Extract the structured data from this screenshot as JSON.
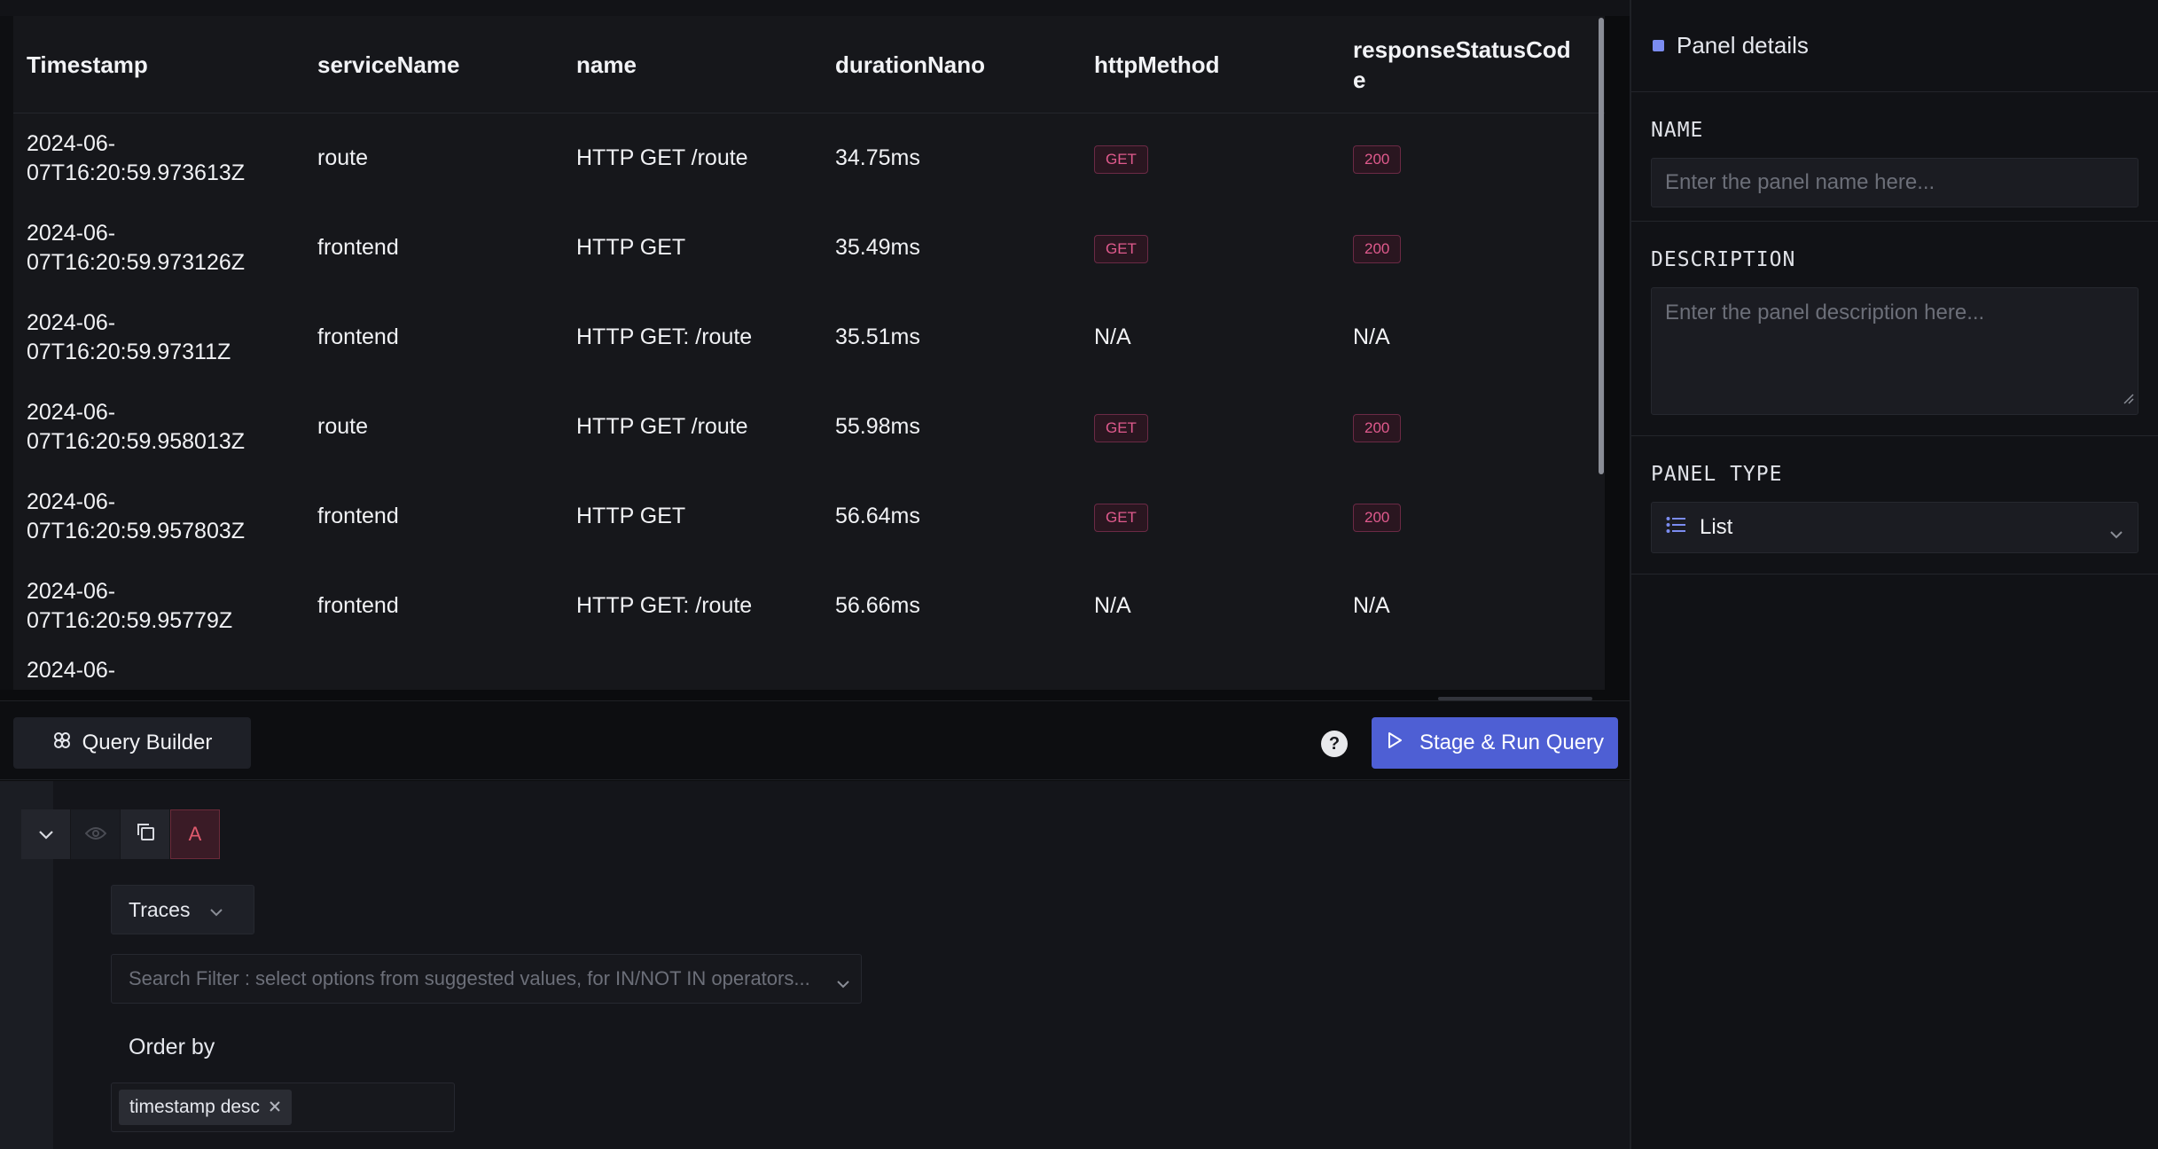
{
  "table": {
    "columns": [
      "Timestamp",
      "serviceName",
      "name",
      "durationNano",
      "httpMethod",
      "responseStatusCode"
    ],
    "rows": [
      {
        "timestamp": "2024-06-07T16:20:59.973613Z",
        "ts_line1": "2024-06-",
        "ts_line2": "07T16:20:59.973613Z",
        "service": "route",
        "name": "HTTP GET /route",
        "duration": "34.75ms",
        "method": "GET",
        "status": "200"
      },
      {
        "timestamp": "2024-06-07T16:20:59.973126Z",
        "ts_line1": "2024-06-",
        "ts_line2": "07T16:20:59.973126Z",
        "service": "frontend",
        "name": "HTTP GET",
        "duration": "35.49ms",
        "method": "GET",
        "status": "200"
      },
      {
        "timestamp": "2024-06-07T16:20:59.97311Z",
        "ts_line1": "2024-06-",
        "ts_line2": "07T16:20:59.97311Z",
        "service": "frontend",
        "name": "HTTP GET: /route",
        "duration": "35.51ms",
        "method": "N/A",
        "status": "N/A"
      },
      {
        "timestamp": "2024-06-07T16:20:59.958013Z",
        "ts_line1": "2024-06-",
        "ts_line2": "07T16:20:59.958013Z",
        "service": "route",
        "name": "HTTP GET /route",
        "duration": "55.98ms",
        "method": "GET",
        "status": "200"
      },
      {
        "timestamp": "2024-06-07T16:20:59.957803Z",
        "ts_line1": "2024-06-",
        "ts_line2": "07T16:20:59.957803Z",
        "service": "frontend",
        "name": "HTTP GET",
        "duration": "56.64ms",
        "method": "GET",
        "status": "200"
      },
      {
        "timestamp": "2024-06-07T16:20:59.95779Z",
        "ts_line1": "2024-06-",
        "ts_line2": "07T16:20:59.95779Z",
        "service": "frontend",
        "name": "HTTP GET: /route",
        "duration": "56.66ms",
        "method": "N/A",
        "status": "N/A"
      },
      {
        "ts_line1": "2024-06-"
      }
    ]
  },
  "toolbar": {
    "query_builder_label": "Query Builder",
    "help_label": "?",
    "run_label": "Stage & Run Query"
  },
  "query": {
    "letter": "A",
    "data_source": "Traces",
    "filter_placeholder": "Search Filter : select options from suggested values, for IN/NOT IN operators...",
    "order_by_label": "Order by",
    "order_by_chip": "timestamp desc"
  },
  "panel": {
    "title": "Panel details",
    "name_label": "NAME",
    "name_placeholder": "Enter the panel name here...",
    "description_label": "DESCRIPTION",
    "description_placeholder": "Enter the panel description here...",
    "type_label": "PANEL TYPE",
    "type_value": "List"
  },
  "colors": {
    "accent": "#4e5fd4",
    "tag_text": "#e05a8d",
    "background": "#0b0c0e"
  },
  "icons": [
    "query-builder-icon",
    "help-icon",
    "play-icon",
    "chevron-down-icon",
    "eye-icon",
    "copy-icon",
    "close-icon",
    "list-icon",
    "panel-dot-icon"
  ]
}
